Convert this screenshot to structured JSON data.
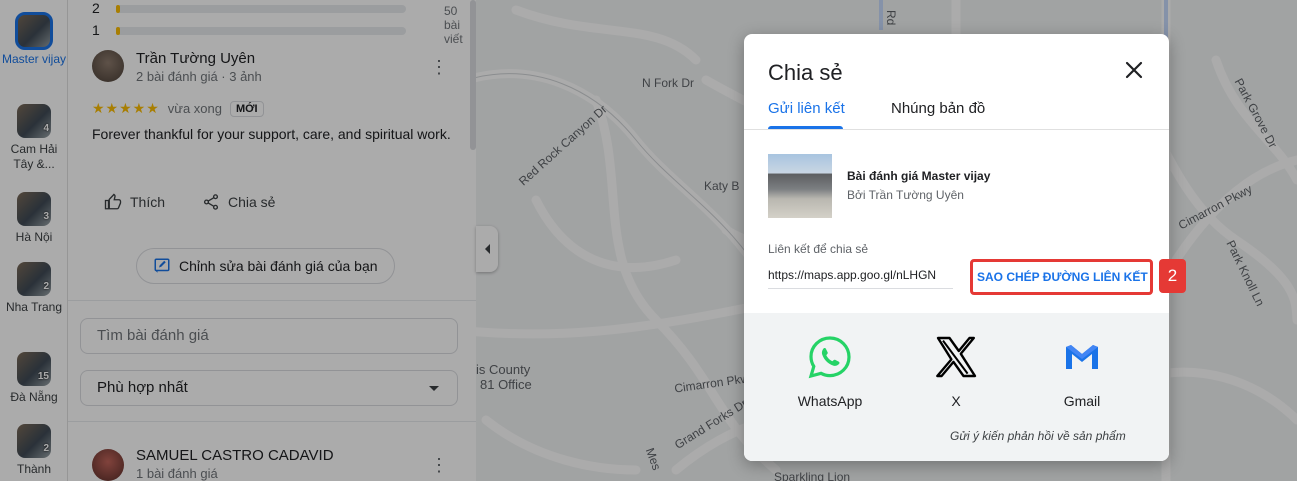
{
  "rail": [
    {
      "label": "Master vijay",
      "active": true,
      "badge": ""
    },
    {
      "label": "Cam Hải Tây &...",
      "active": false,
      "badge": "4"
    },
    {
      "label": "Hà Nội",
      "active": false,
      "badge": "3"
    },
    {
      "label": "Nha Trang",
      "active": false,
      "badge": "2"
    },
    {
      "label": "Đà Nẵng",
      "active": false,
      "badge": "15"
    },
    {
      "label": "Thành",
      "active": false,
      "badge": "2"
    }
  ],
  "distribution": {
    "row2_label": "2",
    "row1_label": "1",
    "count_text": "50 bài viết"
  },
  "review": {
    "author": "Trần Tường Uyên",
    "meta": "2 bài đánh giá · 3 ảnh",
    "stars": "★★★★★",
    "time": "vừa xong",
    "new_badge": "MỚI",
    "text": "Forever thankful for your support, care, and spiritual work.",
    "like_label": "Thích",
    "share_label": "Chia sẻ",
    "edit_label": "Chỉnh sửa bài đánh giá của bạn"
  },
  "search": {
    "placeholder": "Tìm bài đánh giá"
  },
  "sort": {
    "value": "Phù hợp nhất"
  },
  "review2": {
    "author": "SAMUEL CASTRO CADAVID",
    "meta": "1 bài đánh giá"
  },
  "map": {
    "labels": [
      "N Fork Dr",
      "Red Rock Canyon Dr",
      "Katy B",
      "is County",
      "81 Office",
      "Cimarron Pkwy",
      "Grand Forks Dr",
      "Sparkling Lion",
      "Park Grove Dr",
      "Cimarron Pkwy",
      "Park Knoll Ln",
      "Rd",
      "Mes"
    ]
  },
  "dialog": {
    "title": "Chia sẻ",
    "tabs": [
      "Gửi liên kết",
      "Nhúng bản đồ"
    ],
    "place_title": "Bài đánh giá Master vijay",
    "author_line": "Bởi Trần Tường Uyên",
    "link_label": "Liên kết để chia sẻ",
    "link_url": "https://maps.app.goo.gl/nLHGN",
    "copy_label": "SAO CHÉP ĐƯỜNG LIÊN KẾT",
    "share_options": [
      "WhatsApp",
      "X",
      "Gmail"
    ],
    "feedback": "Gửi ý kiến phản hồi về sản phẩm"
  },
  "annotation": {
    "step": "2"
  },
  "colors": {
    "accent": "#1a73e8",
    "highlight": "#e53935",
    "star": "#fbbc04",
    "whatsapp": "#25d366"
  }
}
